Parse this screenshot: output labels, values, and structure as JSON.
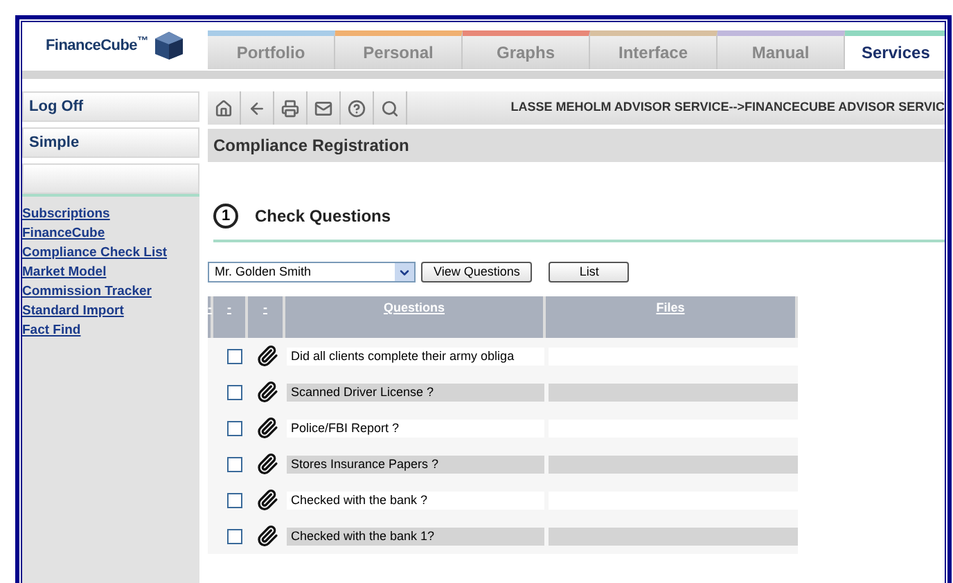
{
  "logo": {
    "text": "FinanceCube",
    "mark": "™"
  },
  "tabs": [
    {
      "label": "Portfolio",
      "selected": false,
      "color": "#a8cce8"
    },
    {
      "label": "Personal",
      "selected": false,
      "color": "#f0b070"
    },
    {
      "label": "Graphs",
      "selected": false,
      "color": "#e88878"
    },
    {
      "label": "Interface",
      "selected": false,
      "color": "#d8c0a0"
    },
    {
      "label": "Manual",
      "selected": false,
      "color": "#c0b8dc"
    },
    {
      "label": "Services",
      "selected": true,
      "color": "#90d8c0"
    }
  ],
  "sidebar": {
    "buttons": [
      "Log Off",
      "Simple"
    ],
    "links": [
      "Subscriptions",
      "FinanceCube",
      "Compliance Check List",
      "Market Model",
      "Commission Tracker",
      "Standard Import",
      "Fact Find"
    ]
  },
  "toolbar": {
    "path": "LASSE MEHOLM ADVISOR SERVICE-->FINANCECUBE ADVISOR SERVIC"
  },
  "page_title": "Compliance Registration",
  "section": {
    "number": "1",
    "title": "Check Questions"
  },
  "client_select": {
    "value": "Mr. Golden Smith"
  },
  "buttons": [
    "View Questions",
    "List"
  ],
  "table": {
    "columns": [
      "-",
      "-",
      "-",
      "Questions",
      "Files"
    ],
    "rows": [
      {
        "question": "Did all clients complete their army obliga",
        "checked": false
      },
      {
        "question": "Scanned Driver License ?",
        "checked": false
      },
      {
        "question": "Police/FBI Report ?",
        "checked": false
      },
      {
        "question": "Stores Insurance Papers ?",
        "checked": false
      },
      {
        "question": "Checked with the bank ?",
        "checked": false
      },
      {
        "question": "Checked with the bank 1?",
        "checked": false
      }
    ]
  }
}
